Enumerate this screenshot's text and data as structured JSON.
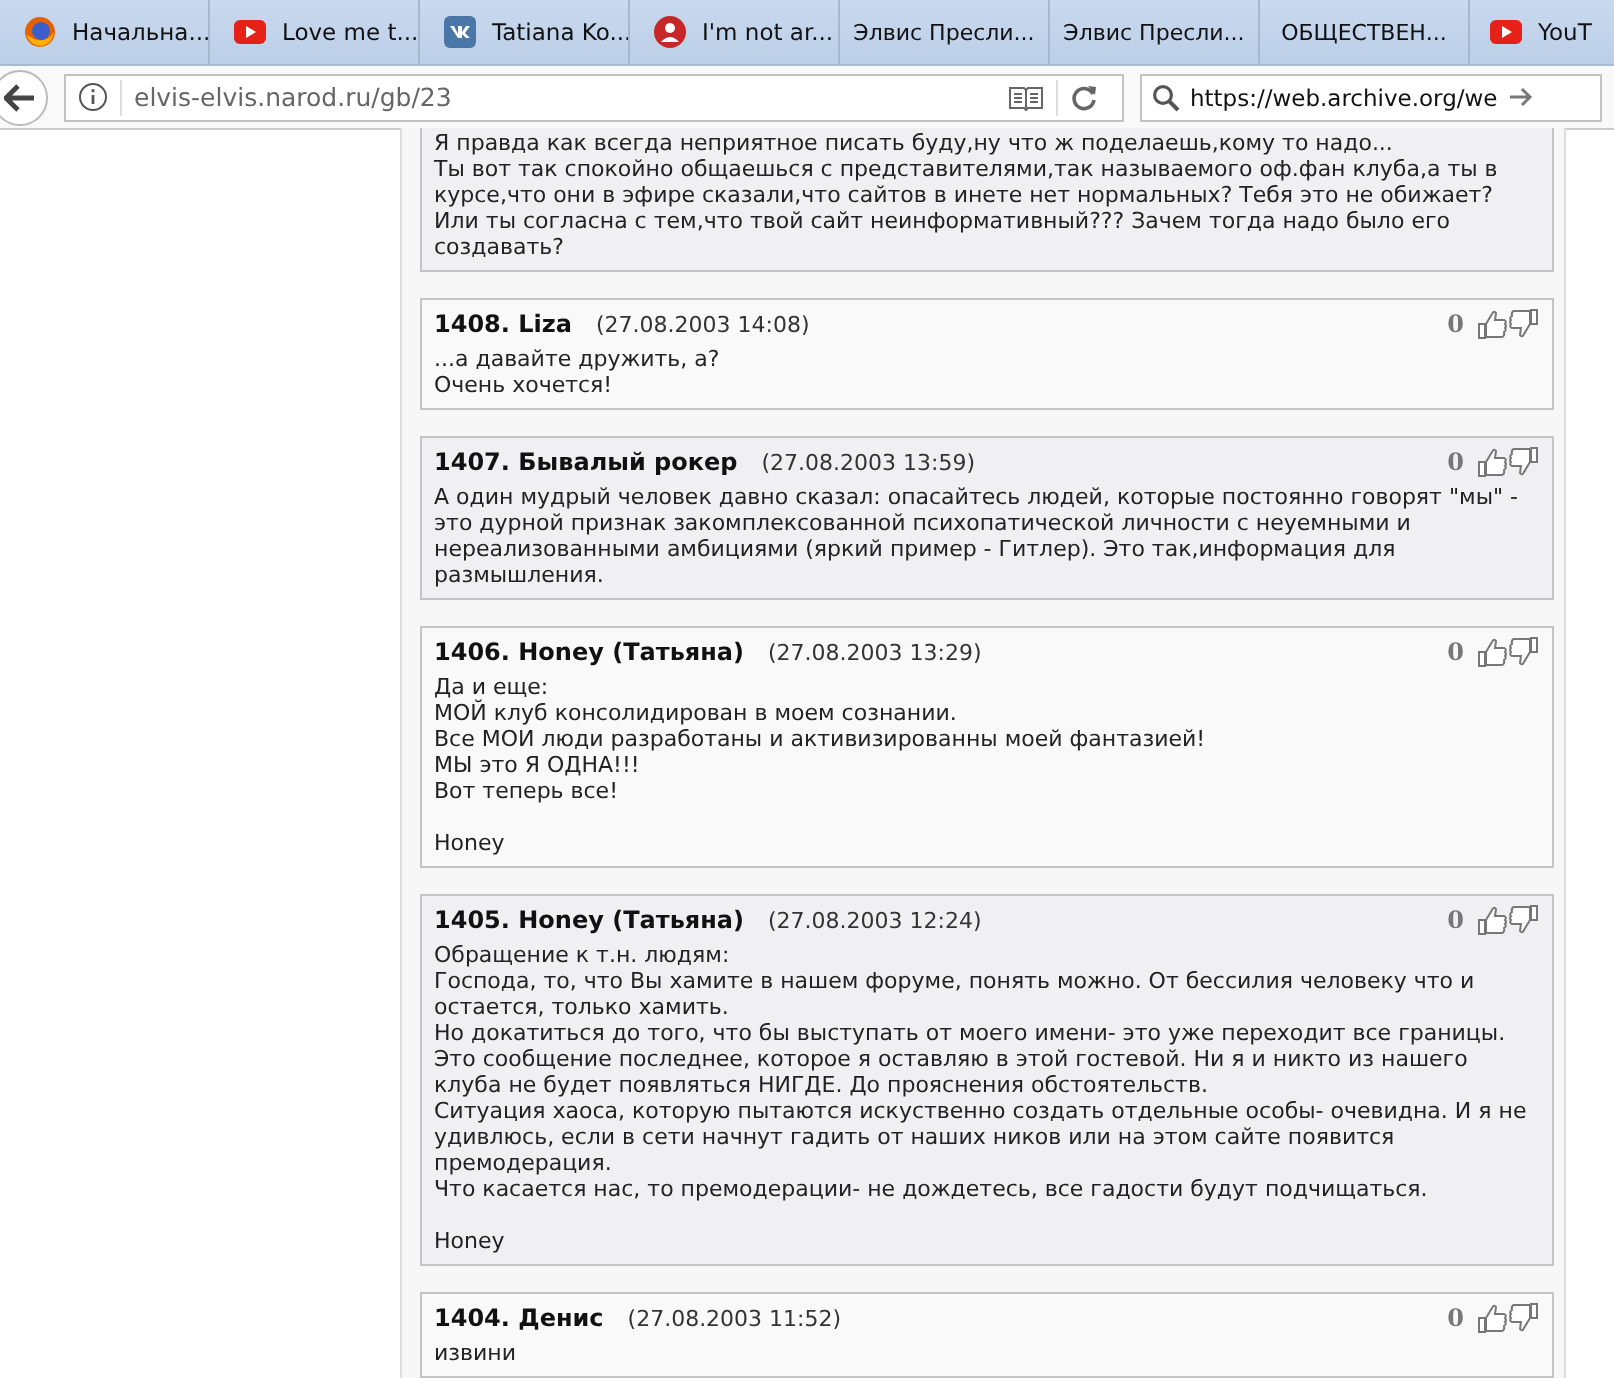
{
  "browser": {
    "tabs": [
      {
        "kind": "firefox",
        "label": "Начальна...",
        "selected": false
      },
      {
        "kind": "youtube",
        "label": "Love me t...",
        "selected": false
      },
      {
        "kind": "vk",
        "label": "Tatiana Ko...",
        "selected": false
      },
      {
        "kind": "avatar",
        "label": "I'm not ar...",
        "selected": false
      },
      {
        "kind": "plain",
        "label": "Элвис Пресли...",
        "selected": false
      },
      {
        "kind": "plain",
        "label": "Элвис Пресли...",
        "selected": false
      },
      {
        "kind": "plain",
        "label": "ОБЩЕСТВЕН...",
        "selected": false
      },
      {
        "kind": "youtube",
        "label": "YouT",
        "selected": false
      }
    ],
    "address": "elvis-elvis.narod.ru/gb/23",
    "search": {
      "value": "https://web.archive.org/we"
    }
  },
  "posts": [
    {
      "lines": [
        "Я правда как всегда неприятное писать буду,ну что ж поделаешь,кому то надо...",
        "Ты вот так спокойно общаешься с представителями,так называемого оф.фан клуба,а ты в",
        "курсе,что они в эфире сказали,что сайтов в инете нет нормальных? Тебя это не обижает?",
        "Или ты согласна с тем,что твой сайт неинформативный??? Зачем тогда надо было его",
        "создавать?"
      ]
    },
    {
      "number": "1408.",
      "author": "Liza",
      "date": "(27.08.2003 14:08)",
      "rating": "0",
      "lines": [
        "...а давайте дружить, а?",
        "Очень хочется!"
      ]
    },
    {
      "number": "1407.",
      "author": "Бывалый рокер",
      "date": "(27.08.2003 13:59)",
      "rating": "0",
      "lines": [
        "А один мудрый человек давно сказал: опасайтесь людей, которые постоянно говорят \"мы\" -",
        "это дурной признак закомплексованной психопатической личности с неуемными и",
        "нереализованными амбициями (яркий пример - Гитлер). Это так,информация для",
        "размышления."
      ]
    },
    {
      "number": "1406.",
      "author": "Honey (Татьяна)",
      "date": "(27.08.2003 13:29)",
      "rating": "0",
      "lines": [
        "Да и еще:",
        "МОЙ клуб консолидирован в моем сознании.",
        "Все МОИ люди разработаны и активизированны моей фантазией!",
        "МЫ это Я ОДНА!!!",
        "Вот теперь все!"
      ],
      "signature": "Honey"
    },
    {
      "number": "1405.",
      "author": "Honey (Татьяна)",
      "date": "(27.08.2003 12:24)",
      "rating": "0",
      "lines": [
        "Обращение к т.н. людям:",
        "Господа, то, что Вы хамите в нашем форуме, понять можно. От бессилия человеку что и",
        "остается, только хамить.",
        "Но докатиться до того, что бы выступать от моего имени- это уже переходит все границы.",
        "Это сообщение последнее, которое я оставляю в этой гостевой. Ни я и никто из нашего",
        "клуба не будет появляться НИГДЕ. До прояснения обстоятельств.",
        "Ситуация хаоса, которую пытаются искуственно создать отдельные особы- очевидна. И я не",
        "удивлюсь, если в сети начнут гадить от наших ников или на этом сайте появится",
        "премодерация.",
        "Что касается нас, то премодерации- не дождетесь, все гадости будут подчищаться."
      ],
      "signature": "Honey"
    },
    {
      "number": "1404.",
      "author": "Денис",
      "date": "(27.08.2003 11:52)",
      "rating": "0",
      "lines": [
        "извини"
      ]
    }
  ]
}
